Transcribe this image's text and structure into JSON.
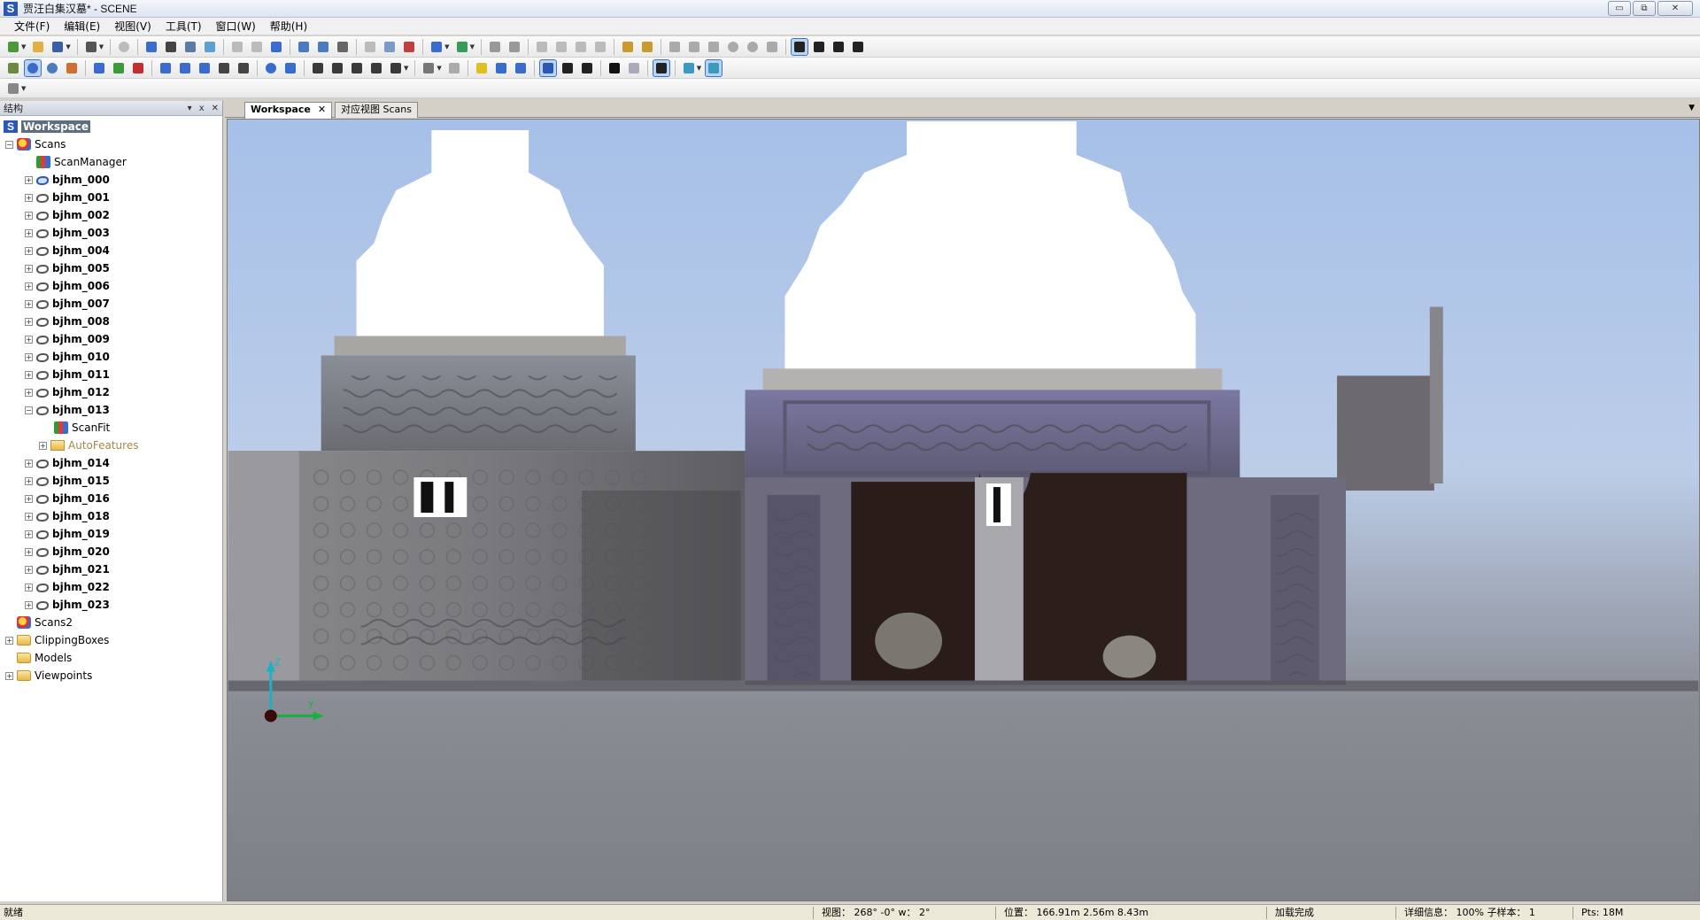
{
  "window": {
    "title": "贾汪白集汉墓* - SCENE",
    "logo": "S",
    "controls": {
      "minimize": "▭",
      "restore": "⧉",
      "close": "✕"
    }
  },
  "menu": [
    "文件(F)",
    "编辑(E)",
    "视图(V)",
    "工具(T)",
    "窗口(W)",
    "帮助(H)"
  ],
  "panel": {
    "title": "结构",
    "controls": {
      "dropdown": "▾",
      "pin": "ⅹ",
      "close": "✕"
    }
  },
  "tree": {
    "workspace": "Workspace",
    "scans": "Scans",
    "scan_manager": "ScanManager",
    "scan_items_a": [
      "bjhm_000",
      "bjhm_001",
      "bjhm_002",
      "bjhm_003",
      "bjhm_004",
      "bjhm_005",
      "bjhm_006",
      "bjhm_007",
      "bjhm_008",
      "bjhm_009",
      "bjhm_010",
      "bjhm_011",
      "bjhm_012",
      "bjhm_013"
    ],
    "scan_fit": "ScanFit",
    "auto_features": "AutoFeatures",
    "scan_items_b": [
      "bjhm_014",
      "bjhm_015",
      "bjhm_016",
      "bjhm_018",
      "bjhm_019",
      "bjhm_020",
      "bjhm_021",
      "bjhm_022",
      "bjhm_023"
    ],
    "scans2": "Scans2",
    "clipping_boxes": "ClippingBoxes",
    "models": "Models",
    "viewpoints": "Viewpoints"
  },
  "tabs": {
    "workspace": "Workspace",
    "scans_view": "对应视图 Scans",
    "close": "✕",
    "menu": "▼"
  },
  "axes": {
    "z": "Z",
    "y": "Y"
  },
  "status": {
    "ready": "就绪",
    "view": "视图： 268° -0° w： 2°",
    "position": "位置： 166.91m 2.56m 8.43m",
    "load": "加载完成",
    "detail": "详细信息： 100%  子样本： 1",
    "pts": "Pts: 18M"
  }
}
